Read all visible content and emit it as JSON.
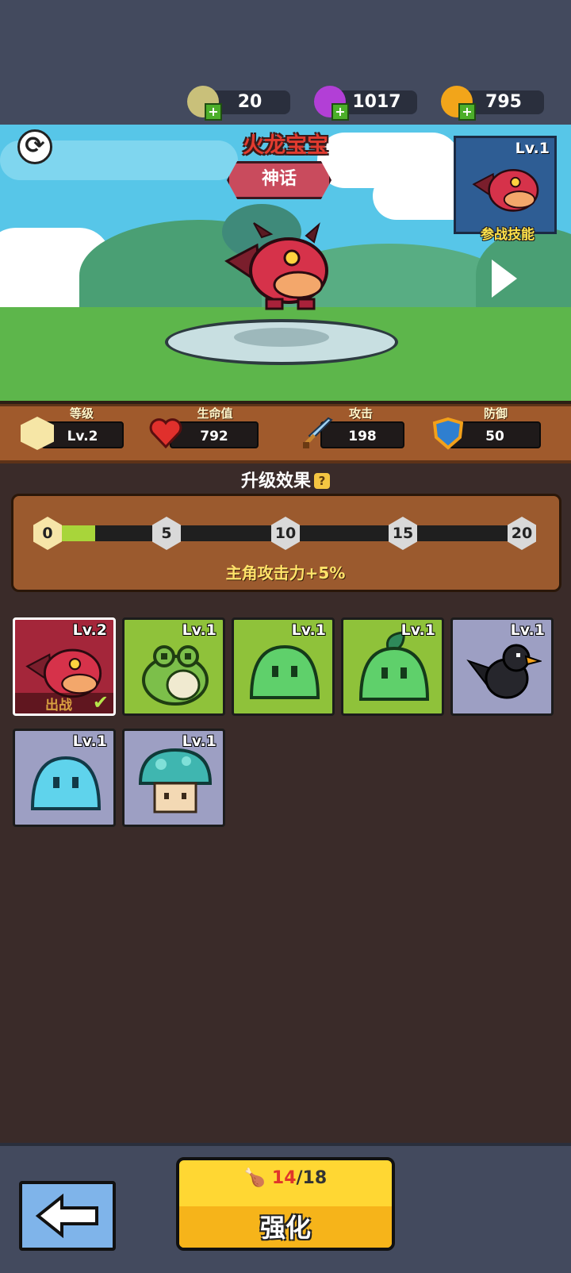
{
  "resources": [
    {
      "name": "egg",
      "value": "20",
      "icon": "egg-icon",
      "color": "#c9c07a"
    },
    {
      "name": "gem",
      "value": "1017",
      "icon": "purple-gem-icon",
      "color": "#b23fd6"
    },
    {
      "name": "coin",
      "value": "795",
      "icon": "gold-coin-icon",
      "color": "#f2a51a"
    }
  ],
  "pet": {
    "name": "火龙宝宝",
    "rarity": "神话",
    "skill": {
      "level": "Lv.1",
      "label": "参战技能"
    }
  },
  "stats": [
    {
      "label": "等级",
      "value": "Lv.2",
      "icon": "level-star-icon"
    },
    {
      "label": "生命值",
      "value": "792",
      "icon": "heart-icon"
    },
    {
      "label": "攻击",
      "value": "198",
      "icon": "sword-icon"
    },
    {
      "label": "防御",
      "value": "50",
      "icon": "shield-icon"
    }
  ],
  "upgrade": {
    "title": "升级效果",
    "help": "?",
    "milestones": [
      "0",
      "5",
      "10",
      "15",
      "20"
    ],
    "progress": 0.1,
    "effect": "主角攻击力+5%"
  },
  "pets": [
    {
      "name": "fire-dragon",
      "level": "Lv.2",
      "status": "出战",
      "selected": true
    },
    {
      "name": "frog",
      "level": "Lv.1"
    },
    {
      "name": "green-slime",
      "level": "Lv.1"
    },
    {
      "name": "leaf-slime",
      "level": "Lv.1"
    },
    {
      "name": "crow",
      "level": "Lv.1"
    },
    {
      "name": "blue-slime",
      "level": "Lv.1"
    },
    {
      "name": "mushroom",
      "level": "Lv.1"
    }
  ],
  "bottom": {
    "cost_have": "14",
    "cost_need": "/18",
    "cost_icon": "drumstick-icon",
    "enhance_label": "强化",
    "back_icon": "back-arrow-icon"
  },
  "colors": {
    "card_dragon": "#a4263a",
    "card_green": "#8fc23a",
    "card_gray": "#9d9fc3"
  }
}
